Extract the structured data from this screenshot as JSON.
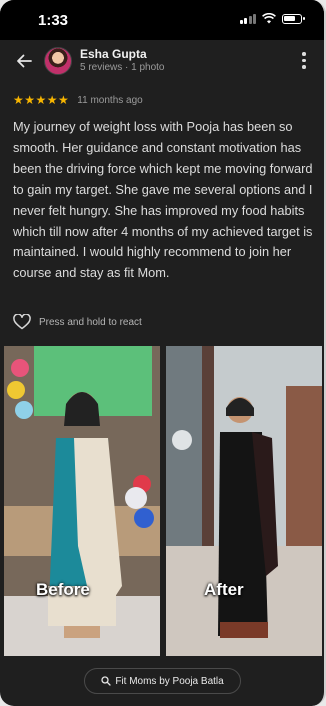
{
  "status_bar": {
    "time": "1:33"
  },
  "review_header": {
    "user_name": "Esha Gupta",
    "user_meta": "5 reviews · 1 photo"
  },
  "rating": {
    "stars": "★★★★★",
    "value": 5,
    "max": 5,
    "time_ago": "11 months ago"
  },
  "review_text": "My journey of weight loss with Pooja has been so smooth. Her guidance and constant motivation has been the driving force which kept me moving forward to gain my target. She gave me several options and I never felt hungry. She has improved my food habits which till now after 4 months of my achieved target is maintained. I would highly recommend to join her course and stay as fit Mom.",
  "react": {
    "label": "Press and hold to react"
  },
  "photos": {
    "before_caption": "Before",
    "after_caption": "After"
  },
  "footer": {
    "place_label": "Fit Moms by Pooja Batla"
  },
  "colors": {
    "background": "#1f1f1f",
    "star": "#f7b500",
    "text": "#dcdcdc",
    "muted": "#9b9b9b"
  },
  "icons": [
    "back-arrow-icon",
    "more-vertical-icon",
    "heart-outline-icon",
    "search-icon",
    "wifi-icon",
    "battery-icon",
    "signal-icon"
  ]
}
